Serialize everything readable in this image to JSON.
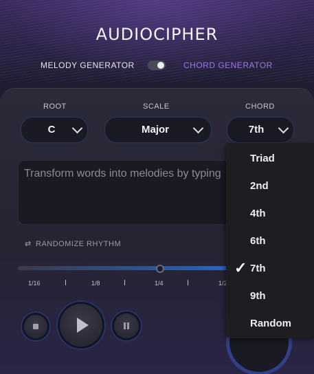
{
  "logo": "AUDIOCIPHER",
  "modes": {
    "melody": "MELODY GENERATOR",
    "chord": "CHORD GENERATOR",
    "toggle_on": true
  },
  "labels": {
    "root": "ROOT",
    "scale": "SCALE",
    "chord": "CHORD"
  },
  "selects": {
    "root": "C",
    "scale": "Major",
    "chord": "7th"
  },
  "input": {
    "placeholder": "Transform words into melodies by typing"
  },
  "randomize": "RANDOMIZE RHYTHM",
  "ticks": [
    "1/16",
    "1/8",
    "1/4",
    "1/2"
  ],
  "dropdown": {
    "options": [
      "Triad",
      "2nd",
      "4th",
      "6th",
      "7th",
      "9th",
      "Random"
    ],
    "selected": "7th",
    "check_icon": "checkmark-icon"
  },
  "icons": {
    "shuffle": "shuffle-icon",
    "stop": "stop-icon",
    "play": "play-icon",
    "pause": "pause-icon",
    "chevron": "chevron-down-icon"
  },
  "colors": {
    "accent_purple": "#9b78e8",
    "accent_blue": "#2a6ad0"
  }
}
